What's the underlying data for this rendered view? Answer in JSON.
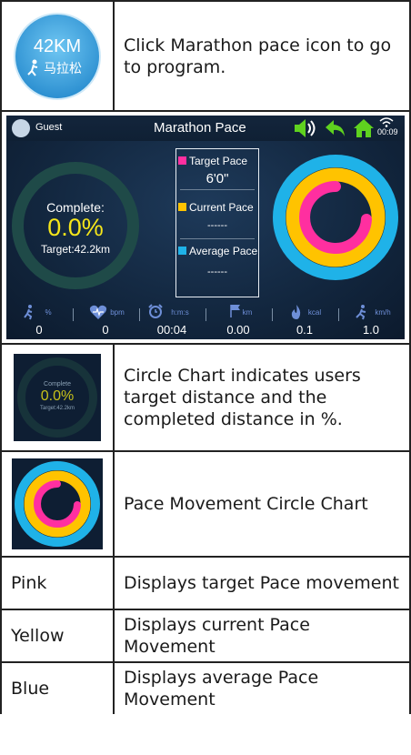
{
  "rows": {
    "icon_row": {
      "badge_text": "42KM",
      "badge_subtext": "马拉松",
      "text": "Click Marathon pace icon to go to program."
    },
    "screen": {
      "guest": "Guest",
      "title": "Marathon Pace",
      "time": "00:09",
      "complete_label": "Complete:",
      "complete_value": "0.0%",
      "target_label": "Target:42.2km",
      "target_pace_label": "Target Pace",
      "target_pace_value": "6'0\"",
      "current_pace_label": "Current Pace",
      "current_pace_value": "------",
      "average_pace_label": "Average Pace",
      "average_pace_value": "------",
      "stats": [
        {
          "unit": "%",
          "value": "0",
          "icon": "runner-incline-icon"
        },
        {
          "unit": "bpm",
          "value": "0",
          "icon": "heart-icon"
        },
        {
          "unit": "h:m:s",
          "value": "00:04",
          "icon": "alarm-clock-icon"
        },
        {
          "unit": "km",
          "value": "0.00",
          "icon": "flag-icon"
        },
        {
          "unit": "kcal",
          "value": "0.1",
          "icon": "flame-icon"
        },
        {
          "unit": "km/h",
          "value": "1.0",
          "icon": "runner-icon"
        }
      ],
      "colors": {
        "pink": "#ff2fa0",
        "yellow": "#ffc300",
        "blue": "#1fb2e8",
        "green": "#5fd21f",
        "value_yellow": "#f5e61a"
      }
    },
    "circle_row": {
      "thumb_label": "Complete",
      "thumb_value": "0.0%",
      "thumb_sub": "Target:42.2km",
      "text": "Circle Chart indicates users target distance and the completed distance in %."
    },
    "pace_row": {
      "text": "Pace Movement Circle Chart"
    },
    "legend": [
      {
        "color": "Pink",
        "text": "Displays target Pace movement"
      },
      {
        "color": "Yellow",
        "text": "Displays current Pace Movement"
      },
      {
        "color": "Blue",
        "text": "Displays average Pace Movement"
      }
    ]
  }
}
